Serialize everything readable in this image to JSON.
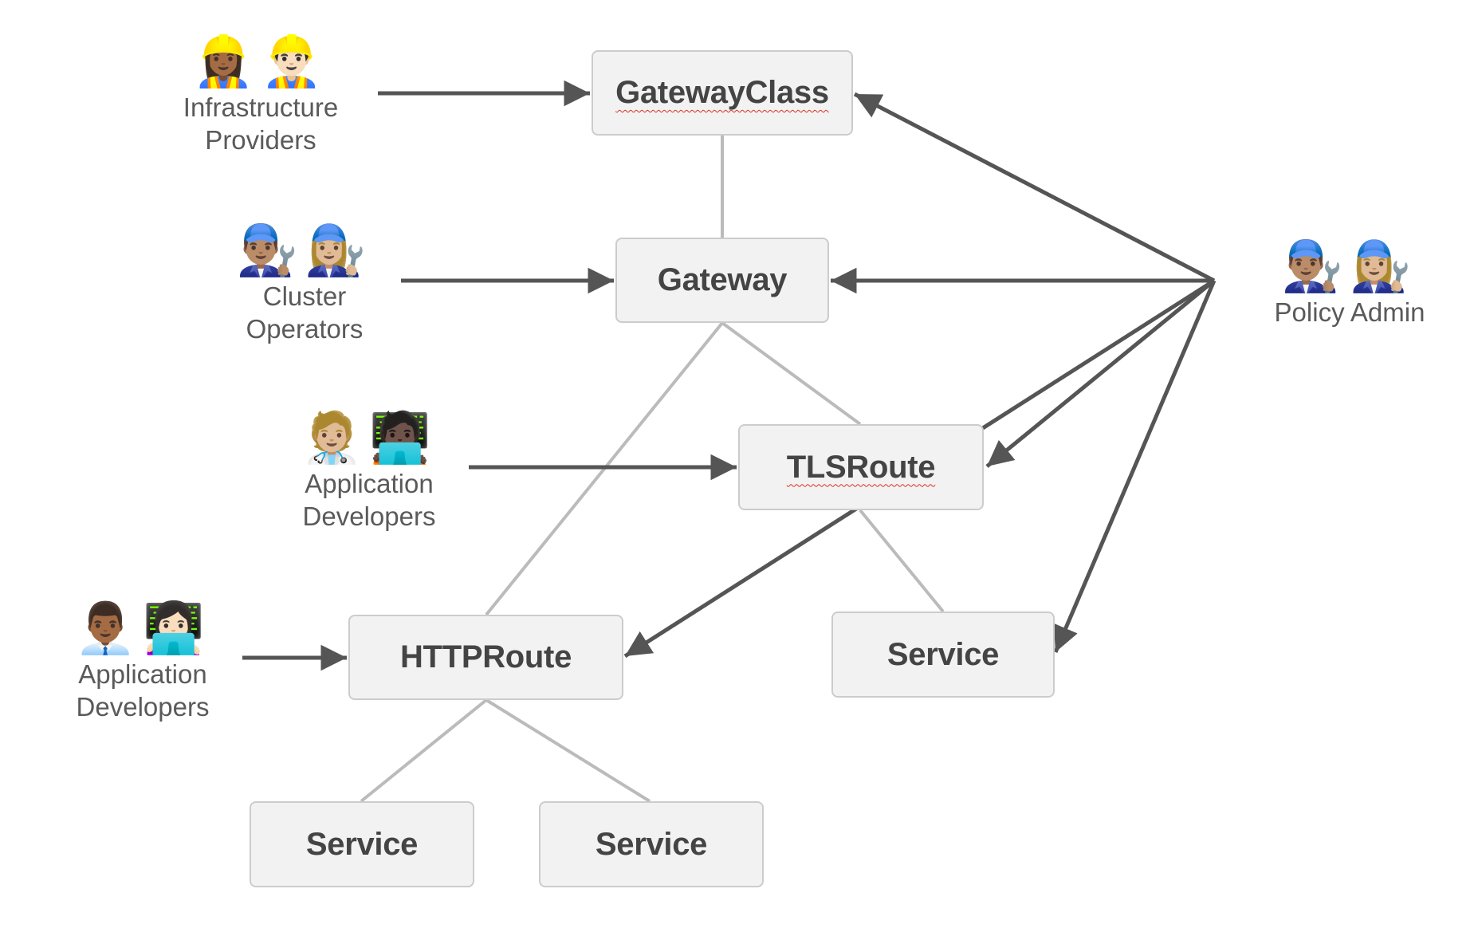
{
  "colors": {
    "arrow": "#555555",
    "connector": "#bbbbbb",
    "node_fill": "#f2f2f2",
    "node_border": "#cccccc",
    "node_text": "#444444",
    "label_text": "#5a5a5a",
    "spellcheck_underline": "#d93025"
  },
  "nodes": {
    "gatewayclass": {
      "label": "GatewayClass"
    },
    "gateway": {
      "label": "Gateway"
    },
    "tlsroute": {
      "label": "TLSRoute"
    },
    "httproute": {
      "label": "HTTPRoute"
    },
    "service_tls": {
      "label": "Service"
    },
    "service_http_1": {
      "label": "Service"
    },
    "service_http_2": {
      "label": "Service"
    }
  },
  "personas": {
    "infrastructure_providers": {
      "label_line1": "Infrastructure",
      "label_line2": "Providers",
      "icons": "👷🏾‍♀️👷🏻‍♂️",
      "icon_names": [
        "construction-worker-woman-icon",
        "construction-worker-man-icon"
      ]
    },
    "cluster_operators": {
      "label_line1": "Cluster",
      "label_line2": "Operators",
      "icons": "👨🏽‍🔧👩🏼‍🔧",
      "icon_names": [
        "mechanic-man-icon",
        "mechanic-woman-icon"
      ]
    },
    "application_developers_tls": {
      "label_line1": "Application",
      "label_line2": "Developers",
      "icons": "🧑🏼‍⚕️🧑🏿‍💻",
      "icon_names": [
        "health-worker-icon",
        "technologist-icon"
      ]
    },
    "application_developers_http": {
      "label_line1": "Application",
      "label_line2": "Developers",
      "icons": "👨🏾‍💼👩🏻‍💻",
      "icon_names": [
        "office-worker-man-icon",
        "technologist-woman-icon"
      ]
    },
    "policy_admin": {
      "label_line1": "Policy Admin",
      "icons": "👨🏽‍🔧👩🏼‍🔧",
      "icon_names": [
        "mechanic-man-icon",
        "mechanic-woman-icon"
      ]
    }
  },
  "relations": {
    "connectors": [
      [
        "gatewayclass",
        "gateway"
      ],
      [
        "gateway",
        "httproute"
      ],
      [
        "gateway",
        "tlsroute"
      ],
      [
        "tlsroute",
        "service_tls"
      ],
      [
        "httproute",
        "service_http_1"
      ],
      [
        "httproute",
        "service_http_2"
      ]
    ],
    "persona_arrows": [
      [
        "infrastructure_providers",
        "gatewayclass"
      ],
      [
        "cluster_operators",
        "gateway"
      ],
      [
        "application_developers_tls",
        "tlsroute"
      ],
      [
        "application_developers_http",
        "httproute"
      ]
    ],
    "policy_admin_arrows": [
      "gatewayclass",
      "gateway",
      "tlsroute",
      "httproute",
      "service_tls"
    ]
  }
}
